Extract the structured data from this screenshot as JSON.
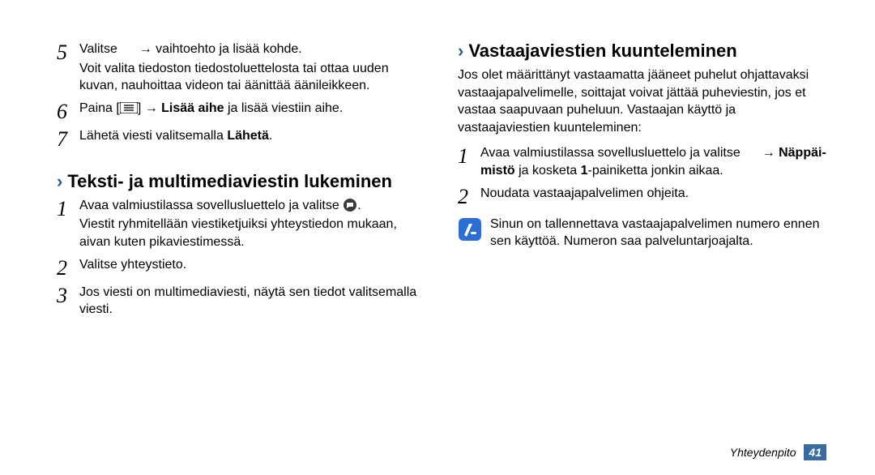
{
  "left": {
    "step5": {
      "num": "5",
      "line1a": "Valitse ",
      "line1b": " → vaihtoehto ja lisää kohde.",
      "line2": "Voit valita tiedoston tiedostoluettelosta tai ottaa uuden kuvan, nauhoittaa videon tai äänittää äänileikkeen."
    },
    "step6": {
      "num": "6",
      "a": "Paina [",
      "b": "] → ",
      "bold": "Lisää aihe",
      "c": " ja lisää viestiin aihe."
    },
    "step7": {
      "num": "7",
      "a": "Lähetä viesti valitsemalla ",
      "bold": "Lähetä",
      "b": "."
    },
    "heading": "Teksti- ja multimediaviestin lukeminen",
    "s1": {
      "num": "1",
      "a": "Avaa valmiustilassa sovellusluettelo ja valitse ",
      "b": ".",
      "line2": "Viestit ryhmitellään viestiketjuiksi yhteystiedon mukaan, aivan kuten pikaviestimessä."
    },
    "s2": {
      "num": "2",
      "a": "Valitse yhteystieto."
    },
    "s3": {
      "num": "3",
      "a": "Jos viesti on multimediaviesti, näytä sen tiedot valitsemalla viesti."
    }
  },
  "right": {
    "heading": "Vastaajaviestien kuunteleminen",
    "intro": "Jos olet määrittänyt vastaamatta jääneet puhelut ohjattavaksi vastaajapalvelimelle, soittajat voivat jättää puheviestin, jos et vastaa saapuvaan puheluun. Vastaajan käyttö ja vastaajaviestien kuunteleminen:",
    "s1": {
      "num": "1",
      "a": "Avaa valmiustilassa sovellusluettelo ja valitse ",
      "b": " → ",
      "bold1": "Näppäi- mistö",
      "c": " ja kosketa ",
      "bold2": "1",
      "d": "-painiketta jonkin aikaa."
    },
    "s2": {
      "num": "2",
      "a": "Noudata vastaajapalvelimen ohjeita."
    },
    "note": "Sinun on tallennettava vastaajapalvelimen numero ennen sen käyttöä. Numeron saa palveluntarjoajalta."
  },
  "footer": {
    "section": "Yhteydenpito",
    "page": "41"
  }
}
